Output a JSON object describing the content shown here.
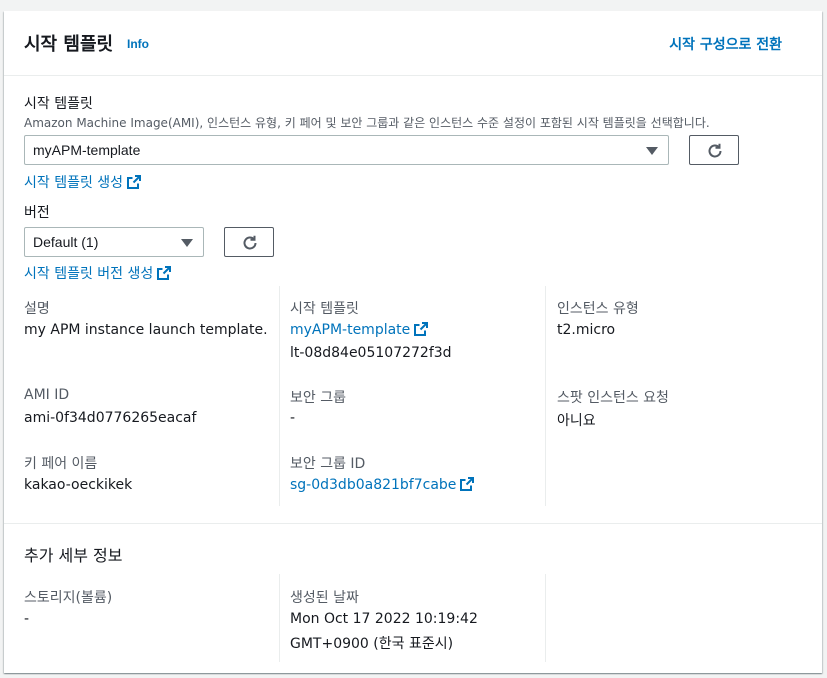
{
  "header": {
    "title": "시작 템플릿",
    "info": "Info",
    "action": "시작 구성으로 전환"
  },
  "template_field": {
    "label": "시작 템플릿",
    "description": "Amazon Machine Image(AMI), 인스턴스 유형, 키 페어 및 보안 그룹과 같은 인스턴스 수준 설정이 포함된 시작 템플릿을 선택합니다.",
    "selected": "myAPM-template",
    "create_link": "시작 템플릿 생성"
  },
  "version_field": {
    "label": "버전",
    "selected": "Default (1)",
    "create_link": "시작 템플릿 버전 생성"
  },
  "details": {
    "description_label": "설명",
    "description_value": "my APM instance launch template.",
    "template_label": "시작 템플릿",
    "template_link": "myAPM-template",
    "template_id": "lt-08d84e05107272f3d",
    "instance_type_label": "인스턴스 유형",
    "instance_type_value": "t2.micro",
    "ami_label": "AMI ID",
    "ami_value": "ami-0f34d0776265eacaf",
    "security_group_label": "보안 그룹",
    "security_group_value": "-",
    "spot_label": "스팟 인스턴스 요청",
    "spot_value": "아니요",
    "key_pair_label": "키 페어 이름",
    "key_pair_value": "kakao-oeckikek",
    "security_group_id_label": "보안 그룹 ID",
    "security_group_id_link": "sg-0d3db0a821bf7cabe"
  },
  "additional": {
    "title": "추가 세부 정보",
    "storage_label": "스토리지(볼륨)",
    "storage_value": "-",
    "created_label": "생성된 날짜",
    "created_value_line1": "Mon Oct 17 2022 10:19:42",
    "created_value_line2": "GMT+0900 (한국 표준시)"
  },
  "colors": {
    "link": "#0073bb",
    "text": "#16191f",
    "muted": "#545b64",
    "divider": "#eaeded"
  }
}
